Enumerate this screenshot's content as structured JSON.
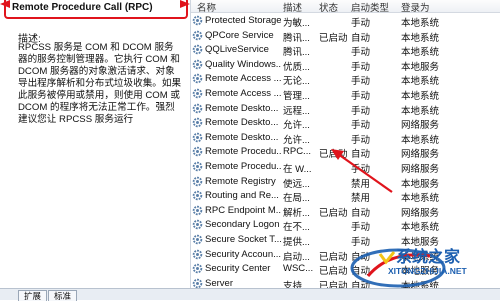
{
  "service": {
    "title": "Remote Procedure Call (RPC)",
    "desc_label": "描述:",
    "desc_text": "RPCSS 服务是 COM 和 DCOM 服务器的服务控制管理器。它执行 COM 和 DCOM 服务器的对象激活请求、对象导出程序解析和分布式垃圾收集。如果此服务被停用或禁用，则使用 COM 或 DCOM 的程序将无法正常工作。强烈建议您让 RPCSS 服务运行"
  },
  "columns": {
    "name": "名称",
    "desc": "描述",
    "status": "状态",
    "startup": "启动类型",
    "logon": "登录为"
  },
  "rows": [
    {
      "name": "Protected Storage",
      "desc": "为敏...",
      "status": "",
      "startup": "手动",
      "logon": "本地系统"
    },
    {
      "name": "QPCore Service",
      "desc": "腾讯...",
      "status": "已启动",
      "startup": "自动",
      "logon": "本地系统"
    },
    {
      "name": "QQLiveService",
      "desc": "腾讯...",
      "status": "",
      "startup": "手动",
      "logon": "本地系统"
    },
    {
      "name": "Quality Windows...",
      "desc": "优质...",
      "status": "",
      "startup": "手动",
      "logon": "本地服务"
    },
    {
      "name": "Remote Access ...",
      "desc": "无论...",
      "status": "",
      "startup": "手动",
      "logon": "本地系统"
    },
    {
      "name": "Remote Access ...",
      "desc": "管理...",
      "status": "",
      "startup": "手动",
      "logon": "本地系统"
    },
    {
      "name": "Remote Deskto...",
      "desc": "远程...",
      "status": "",
      "startup": "手动",
      "logon": "本地系统"
    },
    {
      "name": "Remote Deskto...",
      "desc": "允许...",
      "status": "",
      "startup": "手动",
      "logon": "网络服务"
    },
    {
      "name": "Remote Deskto...",
      "desc": "允许...",
      "status": "",
      "startup": "手动",
      "logon": "本地系统"
    },
    {
      "name": "Remote Procedu...",
      "desc": "RPC...",
      "status": "已启动",
      "startup": "自动",
      "logon": "网络服务"
    },
    {
      "name": "Remote Procedu...",
      "desc": "在 W...",
      "status": "",
      "startup": "手动",
      "logon": "网络服务"
    },
    {
      "name": "Remote Registry",
      "desc": "使远...",
      "status": "",
      "startup": "禁用",
      "logon": "本地服务"
    },
    {
      "name": "Routing and Re...",
      "desc": "在局...",
      "status": "",
      "startup": "禁用",
      "logon": "本地系统"
    },
    {
      "name": "RPC Endpoint M...",
      "desc": "解析...",
      "status": "已启动",
      "startup": "自动",
      "logon": "网络服务"
    },
    {
      "name": "Secondary Logon",
      "desc": "在不...",
      "status": "",
      "startup": "手动",
      "logon": "本地系统"
    },
    {
      "name": "Secure Socket T...",
      "desc": "提供...",
      "status": "",
      "startup": "手动",
      "logon": "本地服务"
    },
    {
      "name": "Security Accoun...",
      "desc": "启动...",
      "status": "已启动",
      "startup": "自动",
      "logon": "本地系统"
    },
    {
      "name": "Security Center",
      "desc": "WSC...",
      "status": "已启动",
      "startup": "自动",
      "logon": "本地服务"
    },
    {
      "name": "Server",
      "desc": "支持...",
      "status": "已启动",
      "startup": "自动",
      "logon": "本地系统"
    }
  ],
  "tabs": [
    "扩展",
    "标准"
  ],
  "watermark": {
    "text": "系统之家",
    "url": "XITONGZHIJIA.NET"
  },
  "colors": {
    "highlight_red": "#e0141c",
    "gear_blue": "#5a7fa8",
    "brand_blue": "#1c5fb0"
  }
}
